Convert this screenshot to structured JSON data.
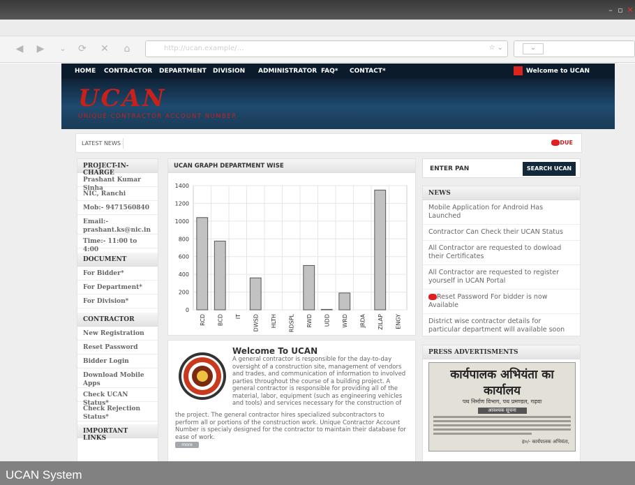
{
  "window": {
    "min_label": "–",
    "max_label": "▫",
    "close_label": "✕"
  },
  "browser": {
    "back_icon": "◀",
    "forward_icon": "▶",
    "dropdown_icon": "⌄",
    "refresh_icon": "⟳",
    "stop_icon": "✕",
    "home_icon": "⌂",
    "url_placeholder": "http://ucan.example/…",
    "star_icon": "☆",
    "search_dd": "⌄"
  },
  "topmenu": {
    "items": [
      "HOME",
      "CONTRACTOR",
      "DEPARTMENT",
      "DIVISION",
      "ADMINISTRATOR",
      "FAQ*",
      "CONTACT*"
    ],
    "welcome": "Welcome to UCAN"
  },
  "banner": {
    "logo": "UCAN",
    "subtitle": "UNIQUE CONTRACTOR ACCOUNT NUMBER"
  },
  "latest_news": {
    "label": "LATEST NEWS",
    "due": "DUE"
  },
  "left": {
    "project_header": "PROJECT-IN-CHARGE",
    "project_items": [
      "Prashant Kumar Sinha",
      "NIC, Ranchi",
      "Mob:- 9471560840",
      "Email:- prashant.ks@nic.in",
      "Time:- 11:00 to 4:00"
    ],
    "document_header": "DOCUMENT",
    "document_items": [
      "For Bidder*",
      "For Department*",
      "For Division*"
    ],
    "contractor_header": "CONTRACTOR",
    "contractor_items": [
      "New Registration",
      "Reset Password",
      "Bidder Login",
      "Download Mobile Apps",
      "Check UCAN Status*",
      "Check Rejection Status*"
    ],
    "links_header": "IMPORTANT LINKS"
  },
  "chart_panel": {
    "header": "UCAN GRAPH DEPARTMENT WISE"
  },
  "chart_data": {
    "type": "bar",
    "categories": [
      "RCD",
      "BCD",
      "IT",
      "DWSD",
      "HLTH",
      "RDSPL",
      "RWD",
      "UDD",
      "WRD",
      "JRDA",
      "ZILAP",
      "ENGY"
    ],
    "values": [
      1040,
      775,
      0,
      360,
      0,
      0,
      500,
      5,
      190,
      0,
      1350,
      0
    ],
    "ylim": [
      0,
      1400
    ],
    "yticks": [
      0,
      200,
      400,
      600,
      800,
      1000,
      1200,
      1400
    ],
    "grid": true
  },
  "welcome": {
    "title": "Welcome To UCAN",
    "para_top": "A general contractor is responsible for the day-to-day oversight of a construction site, management of vendors and trades, and communication of information to involved parties throughout the course of a building project. A general contractor is responsible for providing all of the material, labor, equipment (such as engineering vehicles and tools) and services necessary for the construction of",
    "para_bottom": "the project. The general contractor hires specialized subcontractors to perform all or portions of the construction work. Unique Contractor Account Number is specialy designed for the contractor to maintain their database for ease of work.",
    "more": "more"
  },
  "pan": {
    "label": "ENTER PAN",
    "button": "SEARCH UCAN"
  },
  "news": {
    "header": "NEWS",
    "items": [
      "Mobile Application for Android Has Launched",
      "Contractor Can Check their UCAN Status",
      "All Contractor are requested to dowload their Certificates",
      "All Contractor are requested to register yourself in UCAN Portal",
      "Reset Password For bidder is now Available",
      "District wise contractor details for particular department will available soon"
    ]
  },
  "press": {
    "header": "PRESS ADVERTISMENTS",
    "np_title": "कार्यपालक अभियंता का कार्यालय",
    "np_sub": "पथ निर्माण विभाग, पथ प्रमण्डल, गढ़वा",
    "np_badge": "आवश्यक सूचना",
    "np_sign": "ह०/- कार्यपालक अभियंता,"
  },
  "statusbar": {
    "text": "UCAN System"
  }
}
